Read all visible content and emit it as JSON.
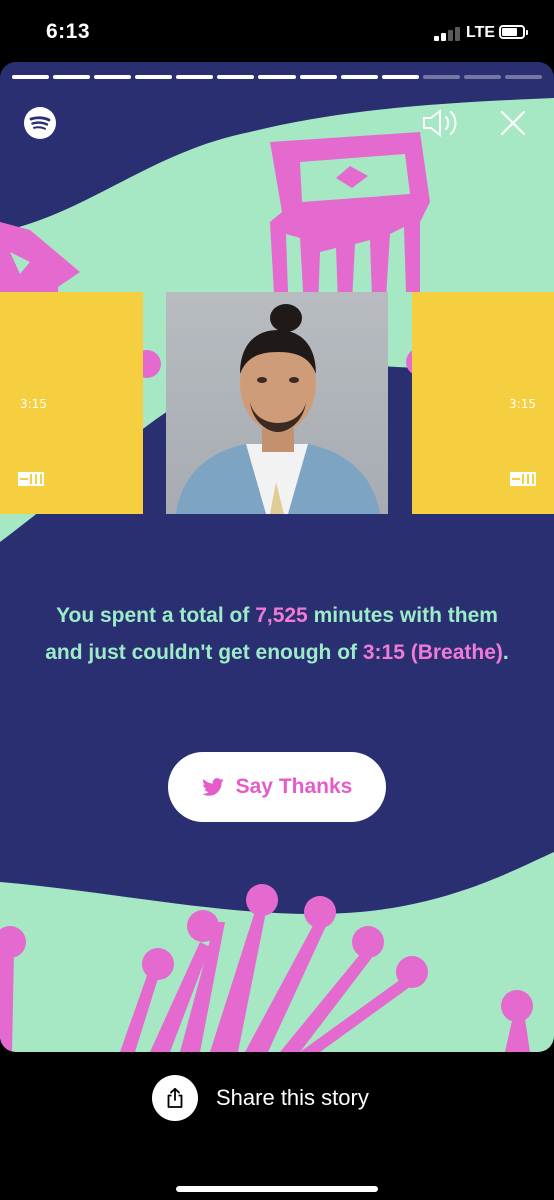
{
  "status_bar": {
    "time": "6:13",
    "network": "LTE",
    "battery_level": 0.85
  },
  "story": {
    "progress": [
      1,
      1,
      1,
      1,
      1,
      1,
      1,
      1,
      1,
      1,
      0,
      0,
      0
    ],
    "cover_time": "3:15",
    "summary": {
      "part1": "You spent a total of ",
      "minutes": "7,525",
      "part2": " minutes with them and just couldn't get enough of ",
      "song": "3:15 (Breathe)",
      "part3": "."
    },
    "thanks_button": {
      "label": "Say Thanks",
      "icon": "twitter-bird-icon"
    }
  },
  "footer": {
    "share_label": "Share this story",
    "share_icon": "share-icon"
  },
  "colors": {
    "background": "#2a2f72",
    "mint": "#a7e8c4",
    "pink": "#e46ad0",
    "yellow": "#f5cf40",
    "text_mint": "#9cecc7",
    "text_pink": "#f07ad6"
  }
}
